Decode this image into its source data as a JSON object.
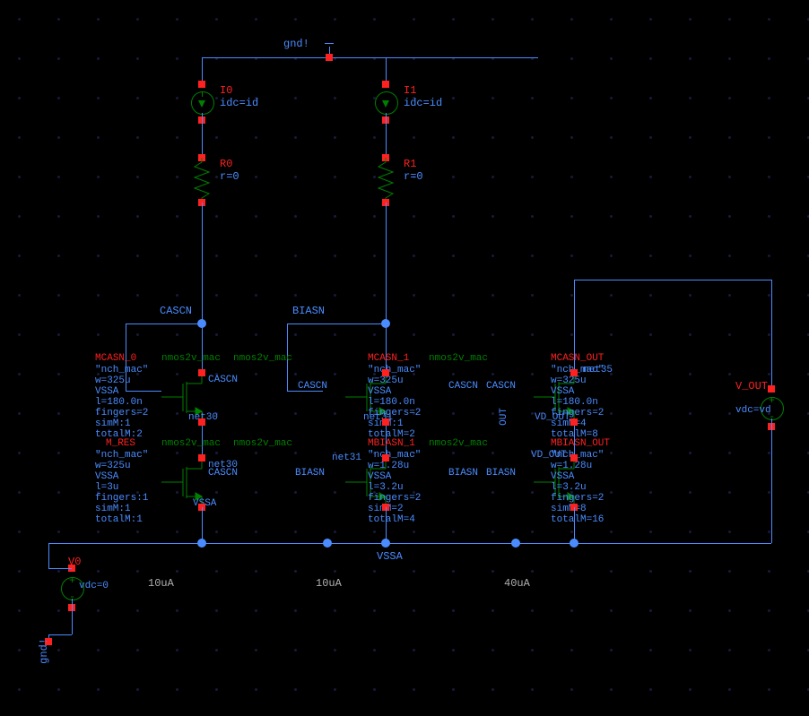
{
  "nets": {
    "gnd": "gnd!",
    "cascn": "CASCN",
    "biasn": "BIASN",
    "vssa": "VSSA",
    "vd_out": "VD_OUT",
    "net30": "net30",
    "net31": "net31",
    "net35": "net35",
    "out": "OUT"
  },
  "sources": {
    "I0": {
      "name": "I0",
      "param": "idc=id"
    },
    "I1": {
      "name": "I1",
      "param": "idc=id"
    },
    "R0": {
      "name": "R0",
      "param": "r=0"
    },
    "R1": {
      "name": "R1",
      "param": "r=0"
    },
    "V0": {
      "name": "V0",
      "param": "vdc=0"
    },
    "VOUT": {
      "name": "V_OUT",
      "param": "vdc=vd"
    }
  },
  "currents": {
    "c1": "10uA",
    "c2": "10uA",
    "c3": "40uA"
  },
  "mos": {
    "mcasn0": {
      "name": "MCASN_0",
      "type": "nmos2v_mac",
      "model": "\"nch_mac\"",
      "w": "w=325u",
      "body": "VSSA",
      "l": "l=180.0n",
      "fingers": "fingers=2",
      "simm": "simM:1",
      "totalm": "totalM:2",
      "gate": "CASCN",
      "drain": "CASCN",
      "src": "net30"
    },
    "mres": {
      "name": "M_RES",
      "type": "nmos2v_mac",
      "model": "\"nch_mac\"",
      "w": "w=325u",
      "body": "VSSA",
      "l": "l=3u",
      "fingers": "fingers:1",
      "simm": "simM:1",
      "totalm": "totalM:1",
      "gate": "CASCN",
      "drain": "net30",
      "src": "VSSA"
    },
    "mcasn1": {
      "name": "MCASN_1",
      "type": "nmos2v_mac",
      "model": "\"nch_mac\"",
      "w": "w=325u",
      "body": "VSSA",
      "l": "l=180.0n",
      "fingers": "fingers=2",
      "simm": "simM:1",
      "totalm": "totalM=2",
      "gate": "CASCN",
      "drain": "BIASN",
      "src": "net31"
    },
    "mbiasn1": {
      "name": "MBIASN_1",
      "type": "nmos2v_mac",
      "model": "\"nch_mac\"",
      "w": "w=1.28u",
      "body": "VSSA",
      "l": "l=3.2u",
      "fingers": "fingers=2",
      "simm": "simM=2",
      "totalm": "totalM=4",
      "gate": "BIASN",
      "drain": "net31",
      "src": "VSSA"
    },
    "mcasn_out": {
      "name": "MCASN_OUT",
      "type": "nmos2v_mac",
      "model": "\"nch_mac\"",
      "w": "w=325u",
      "body": "VSSA",
      "l": "l=180.0n",
      "fingers": "fingers=2",
      "simm": "simM=4",
      "totalm": "totalM=8",
      "gate": "CASCN",
      "drain": "net35",
      "src": "VD_OUT"
    },
    "mbiasn_out": {
      "name": "MBIASN_OUT",
      "type": "nmos2v_mac",
      "model": "\"nch_mac\"",
      "w": "w=1.28u",
      "body": "VSSA",
      "l": "l=3.2u",
      "fingers": "fingers=2",
      "simm": "simM=8",
      "totalm": "totalM=16",
      "gate": "BIASN",
      "drain": "VD_OUT",
      "src": "VSSA"
    },
    "extra_mos_type": "nmos2v_mac"
  }
}
